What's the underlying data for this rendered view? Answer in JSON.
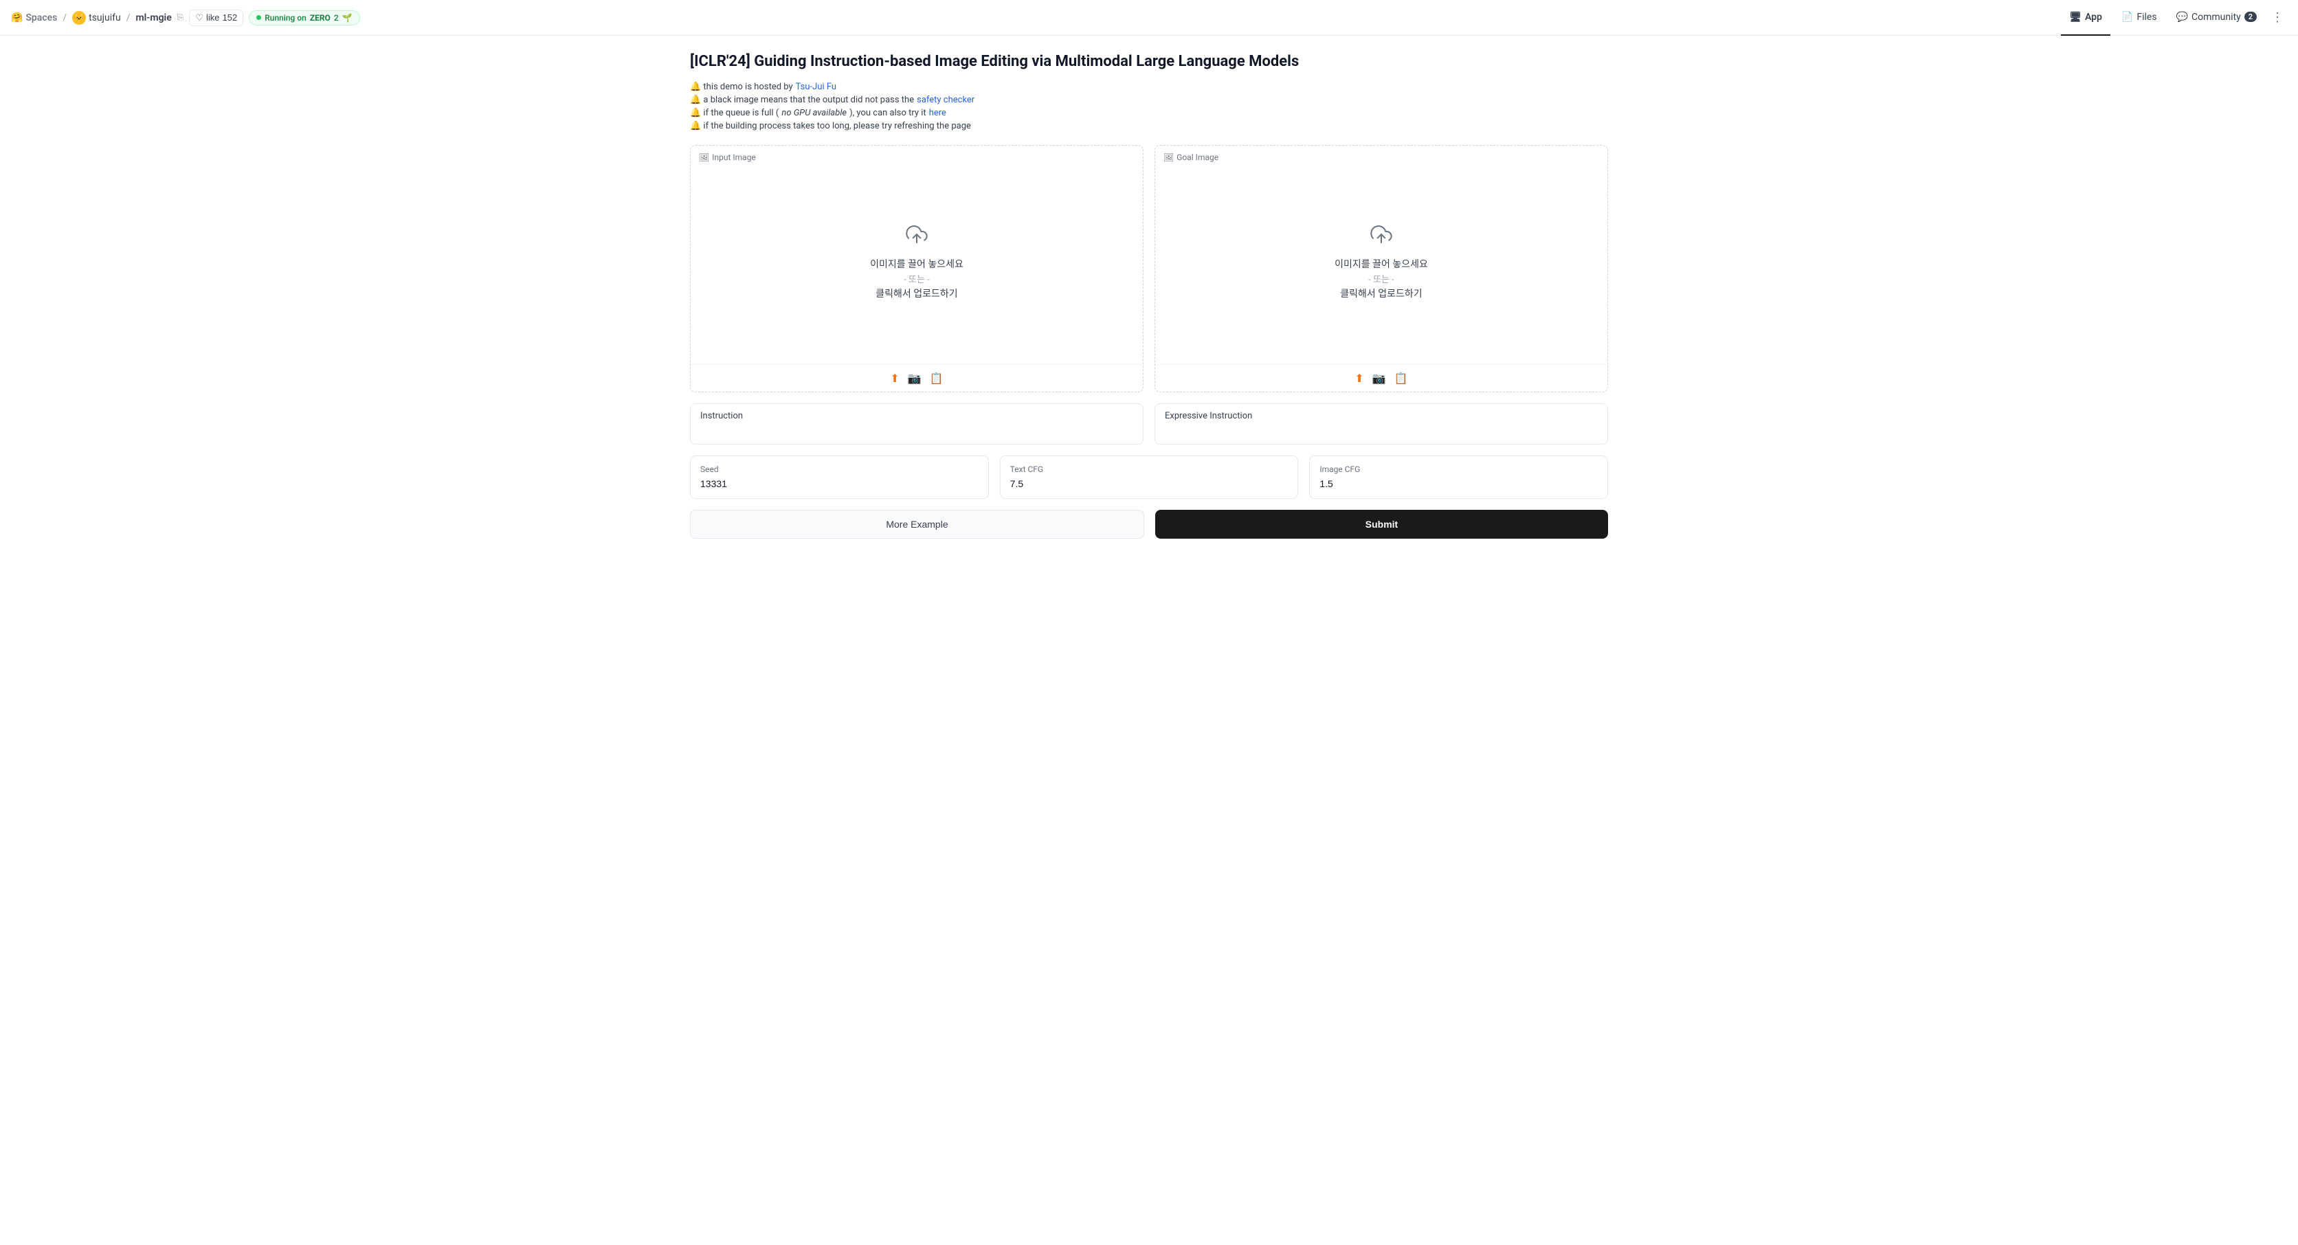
{
  "navbar": {
    "spaces_label": "Spaces",
    "user": "tsujuifu",
    "repo": "ml-mgie",
    "like_label": "like",
    "like_count": "152",
    "running_label": "Running on",
    "running_platform": "ZERO",
    "running_count": "2",
    "tabs": [
      {
        "id": "app",
        "label": "App",
        "active": true,
        "icon": "🖥"
      },
      {
        "id": "files",
        "label": "Files",
        "active": false,
        "icon": "📄"
      },
      {
        "id": "community",
        "label": "Community",
        "active": false,
        "icon": "💬",
        "badge": "2"
      }
    ],
    "more_icon": "⋮"
  },
  "page": {
    "title": "[ICLR'24] Guiding Instruction-based Image Editing via Multimodal Large Language Models",
    "info": [
      {
        "id": "info1",
        "text_before": "🔔 this demo is hosted by ",
        "link_text": "Tsu-Jui Fu",
        "link_url": "#",
        "text_after": ""
      },
      {
        "id": "info2",
        "text_before": "🔔 a black image means that the output did not pass the ",
        "link_text": "safety checker",
        "link_url": "#",
        "text_after": ""
      },
      {
        "id": "info3",
        "text_before": "🔔 if the queue is full (",
        "italic_text": "no GPU available",
        "text_mid": "), you can also try it ",
        "link_text": "here",
        "link_url": "#",
        "text_after": ""
      },
      {
        "id": "info4",
        "text_before": "🔔 if the building process takes too long, please try refreshing the page",
        "text_after": ""
      }
    ]
  },
  "input_image": {
    "label": "Input Image",
    "upload_main": "이미지를 끌어 놓으세요",
    "upload_or": "- 또는 -",
    "upload_click": "클릭해서 업로드하기"
  },
  "goal_image": {
    "label": "Goal Image",
    "upload_main": "이미지를 끌어 놓으세요",
    "upload_or": "- 또는 -",
    "upload_click": "클릭해서 업로드하기"
  },
  "instruction": {
    "label": "Instruction",
    "placeholder": "",
    "value": ""
  },
  "expressive_instruction": {
    "label": "Expressive Instruction",
    "placeholder": "",
    "value": ""
  },
  "seed": {
    "label": "Seed",
    "value": "13331"
  },
  "text_cfg": {
    "label": "Text CFG",
    "value": "7.5"
  },
  "image_cfg": {
    "label": "Image CFG",
    "value": "1.5"
  },
  "buttons": {
    "more_example": "More Example",
    "submit": "Submit"
  }
}
